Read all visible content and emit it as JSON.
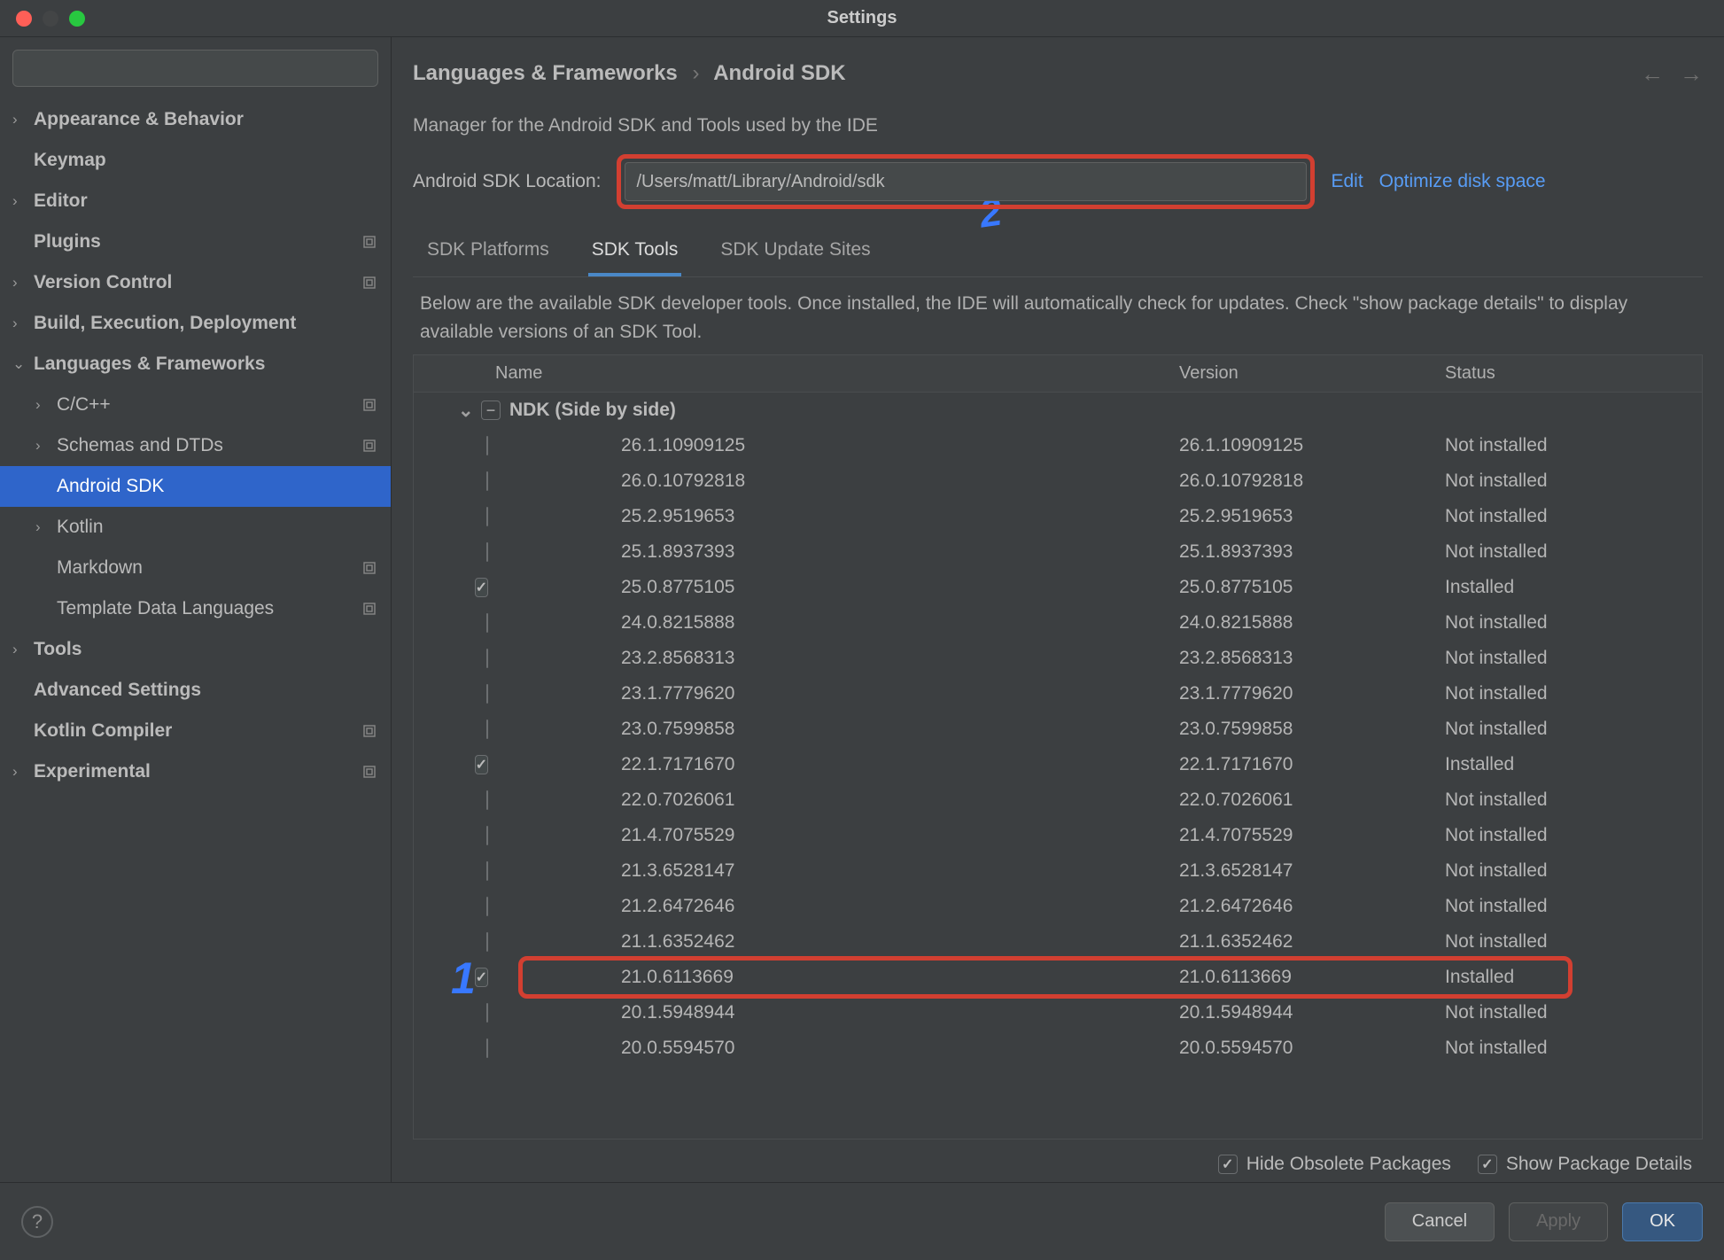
{
  "window": {
    "title": "Settings"
  },
  "search": {
    "placeholder": ""
  },
  "sidebar": {
    "items": [
      {
        "label": "Appearance & Behavior",
        "bold": true,
        "chev": "›",
        "gear": false
      },
      {
        "label": "Keymap",
        "bold": true,
        "chev": "",
        "gear": false
      },
      {
        "label": "Editor",
        "bold": true,
        "chev": "›",
        "gear": false
      },
      {
        "label": "Plugins",
        "bold": true,
        "chev": "",
        "gear": true
      },
      {
        "label": "Version Control",
        "bold": true,
        "chev": "›",
        "gear": true
      },
      {
        "label": "Build, Execution, Deployment",
        "bold": true,
        "chev": "›",
        "gear": false
      },
      {
        "label": "Languages & Frameworks",
        "bold": true,
        "chev": "⌄",
        "gear": false
      },
      {
        "label": "C/C++",
        "bold": false,
        "chev": "›",
        "gear": true,
        "indent": 1
      },
      {
        "label": "Schemas and DTDs",
        "bold": false,
        "chev": "›",
        "gear": true,
        "indent": 1
      },
      {
        "label": "Android SDK",
        "bold": false,
        "chev": "",
        "gear": false,
        "indent": 1,
        "selected": true
      },
      {
        "label": "Kotlin",
        "bold": false,
        "chev": "›",
        "gear": false,
        "indent": 1
      },
      {
        "label": "Markdown",
        "bold": false,
        "chev": "",
        "gear": true,
        "indent": 1
      },
      {
        "label": "Template Data Languages",
        "bold": false,
        "chev": "",
        "gear": true,
        "indent": 1
      },
      {
        "label": "Tools",
        "bold": true,
        "chev": "›",
        "gear": false
      },
      {
        "label": "Advanced Settings",
        "bold": true,
        "chev": "",
        "gear": false
      },
      {
        "label": "Kotlin Compiler",
        "bold": true,
        "chev": "",
        "gear": true
      },
      {
        "label": "Experimental",
        "bold": true,
        "chev": "›",
        "gear": true
      }
    ]
  },
  "breadcrumb": {
    "parent": "Languages & Frameworks",
    "current": "Android SDK"
  },
  "desc": "Manager for the Android SDK and Tools used by the IDE",
  "sdk": {
    "label": "Android SDK Location:",
    "path": "/Users/matt/Library/Android/sdk",
    "edit": "Edit",
    "optimize": "Optimize disk space"
  },
  "tabs": [
    {
      "label": "SDK Platforms",
      "active": false
    },
    {
      "label": "SDK Tools",
      "active": true
    },
    {
      "label": "SDK Update Sites",
      "active": false
    }
  ],
  "tabDesc": "Below are the available SDK developer tools. Once installed, the IDE will automatically check for updates. Check \"show package details\" to display available versions of an SDK Tool.",
  "columns": {
    "name": "Name",
    "version": "Version",
    "status": "Status"
  },
  "group": {
    "label": "NDK (Side by side)"
  },
  "packages": [
    {
      "name": "26.1.10909125",
      "version": "26.1.10909125",
      "status": "Not installed",
      "checked": false
    },
    {
      "name": "26.0.10792818",
      "version": "26.0.10792818",
      "status": "Not installed",
      "checked": false
    },
    {
      "name": "25.2.9519653",
      "version": "25.2.9519653",
      "status": "Not installed",
      "checked": false
    },
    {
      "name": "25.1.8937393",
      "version": "25.1.8937393",
      "status": "Not installed",
      "checked": false
    },
    {
      "name": "25.0.8775105",
      "version": "25.0.8775105",
      "status": "Installed",
      "checked": true
    },
    {
      "name": "24.0.8215888",
      "version": "24.0.8215888",
      "status": "Not installed",
      "checked": false
    },
    {
      "name": "23.2.8568313",
      "version": "23.2.8568313",
      "status": "Not installed",
      "checked": false
    },
    {
      "name": "23.1.7779620",
      "version": "23.1.7779620",
      "status": "Not installed",
      "checked": false
    },
    {
      "name": "23.0.7599858",
      "version": "23.0.7599858",
      "status": "Not installed",
      "checked": false
    },
    {
      "name": "22.1.7171670",
      "version": "22.1.7171670",
      "status": "Installed",
      "checked": true
    },
    {
      "name": "22.0.7026061",
      "version": "22.0.7026061",
      "status": "Not installed",
      "checked": false
    },
    {
      "name": "21.4.7075529",
      "version": "21.4.7075529",
      "status": "Not installed",
      "checked": false
    },
    {
      "name": "21.3.6528147",
      "version": "21.3.6528147",
      "status": "Not installed",
      "checked": false
    },
    {
      "name": "21.2.6472646",
      "version": "21.2.6472646",
      "status": "Not installed",
      "checked": false
    },
    {
      "name": "21.1.6352462",
      "version": "21.1.6352462",
      "status": "Not installed",
      "checked": false
    },
    {
      "name": "21.0.6113669",
      "version": "21.0.6113669",
      "status": "Installed",
      "checked": true,
      "highlighted": true
    },
    {
      "name": "20.1.5948944",
      "version": "20.1.5948944",
      "status": "Not installed",
      "checked": false
    },
    {
      "name": "20.0.5594570",
      "version": "20.0.5594570",
      "status": "Not installed",
      "checked": false
    }
  ],
  "options": {
    "hideObsolete": "Hide Obsolete Packages",
    "showDetails": "Show Package Details"
  },
  "footer": {
    "cancel": "Cancel",
    "apply": "Apply",
    "ok": "OK"
  },
  "annotations": {
    "one": "1",
    "two": "2"
  }
}
